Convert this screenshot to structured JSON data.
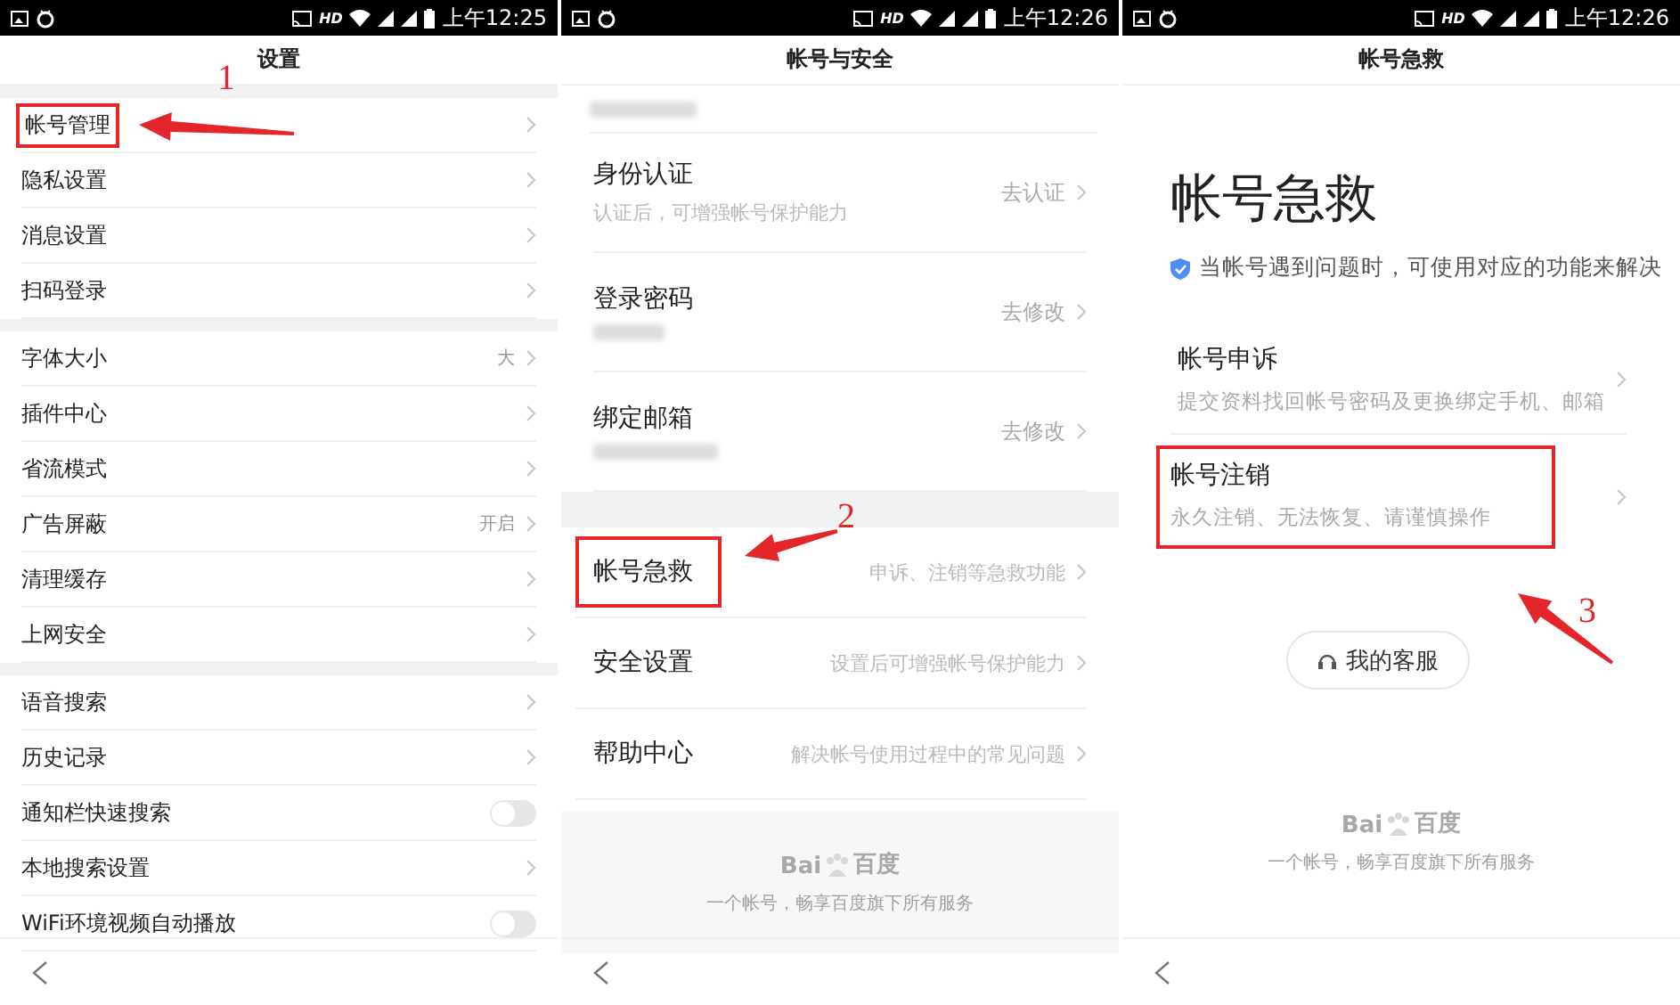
{
  "screens": [
    {
      "kind": "settings",
      "status_bar": {
        "network": "HD",
        "time": "上午12:25"
      },
      "title": "设置",
      "annotation": {
        "number": "1"
      },
      "groups": [
        {
          "items": [
            {
              "kind": "link",
              "label": "帐号管理",
              "highlighted": true
            },
            {
              "kind": "link",
              "label": "隐私设置"
            },
            {
              "kind": "link",
              "label": "消息设置"
            },
            {
              "kind": "link",
              "label": "扫码登录"
            }
          ]
        },
        {
          "items": [
            {
              "kind": "link",
              "label": "字体大小",
              "value": "大"
            },
            {
              "kind": "link",
              "label": "插件中心"
            },
            {
              "kind": "link",
              "label": "省流模式"
            },
            {
              "kind": "link",
              "label": "广告屏蔽",
              "value": "开启"
            },
            {
              "kind": "link",
              "label": "清理缓存"
            },
            {
              "kind": "link",
              "label": "上网安全"
            }
          ]
        },
        {
          "items": [
            {
              "kind": "link",
              "label": "语音搜索"
            },
            {
              "kind": "link",
              "label": "历史记录"
            },
            {
              "kind": "toggle",
              "label": "通知栏快速搜索",
              "on": false
            },
            {
              "kind": "link",
              "label": "本地搜索设置"
            },
            {
              "kind": "toggle",
              "label": "WiFi环境视频自动播放",
              "on": false
            }
          ]
        }
      ]
    },
    {
      "kind": "account_security",
      "status_bar": {
        "network": "HD",
        "time": "上午12:26"
      },
      "title": "帐号与安全",
      "annotation": {
        "number": "2"
      },
      "groups": [
        {
          "items": [
            {
              "kind": "masked"
            },
            {
              "kind": "detail",
              "label": "身份认证",
              "subtitle": "认证后，可增强帐号保护能力",
              "action": "去认证"
            },
            {
              "kind": "detail",
              "label": "登录密码",
              "masked": true,
              "action": "去修改"
            },
            {
              "kind": "detail",
              "label": "绑定邮箱",
              "masked": true,
              "action": "去修改"
            }
          ]
        },
        {
          "items": [
            {
              "kind": "hint",
              "label": "帐号急救",
              "hint": "申诉、注销等急救功能",
              "highlighted": true
            },
            {
              "kind": "hint",
              "label": "安全设置",
              "hint": "设置后可增强帐号保护能力"
            },
            {
              "kind": "hint",
              "label": "帮助中心",
              "hint": "解决帐号使用过程中的常见问题"
            }
          ]
        }
      ],
      "footer": {
        "logo_left": "Bai",
        "logo_right": "百度",
        "slogan": "一个帐号，畅享百度旗下所有服务"
      }
    },
    {
      "kind": "rescue",
      "status_bar": {
        "network": "HD",
        "time": "上午12:26"
      },
      "title": "帐号急救",
      "annotation": {
        "number": "3"
      },
      "heading": "帐号急救",
      "notice": "当帐号遇到问题时，可使用对应的功能来解决",
      "options": [
        {
          "label": "帐号申诉",
          "description": "提交资料找回帐号密码及更换绑定手机、邮箱"
        },
        {
          "label": "帐号注销",
          "description": "永久注销、无法恢复、请谨慎操作",
          "highlighted": true
        }
      ],
      "support_button": "我的客服",
      "footer": {
        "logo_left": "Bai",
        "logo_right": "百度",
        "slogan": "一个帐号，畅享百度旗下所有服务"
      }
    }
  ]
}
